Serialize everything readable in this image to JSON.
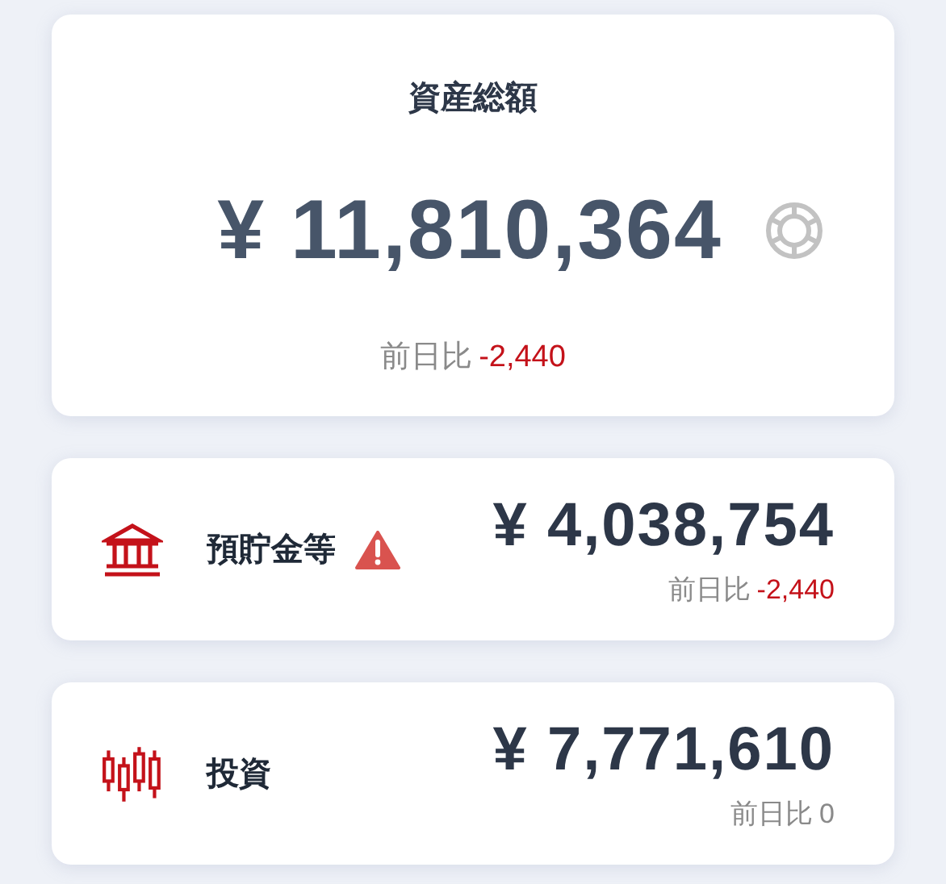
{
  "total": {
    "title": "資産総額",
    "amount": "¥ 11,810,364",
    "change": {
      "label": "前日比",
      "value": "-2,440",
      "color": "#c4121a"
    }
  },
  "accounts": [
    {
      "kind": "bank",
      "name": "預貯金等",
      "warning": true,
      "amount": "¥ 4,038,754",
      "change": {
        "label": "前日比",
        "value": "-2,440",
        "color": "#c4121a"
      }
    },
    {
      "kind": "investment",
      "name": "投資",
      "warning": false,
      "amount": "¥ 7,771,610",
      "change": {
        "label": "前日比",
        "value": "0",
        "color": "#8a8a8a"
      }
    }
  ]
}
